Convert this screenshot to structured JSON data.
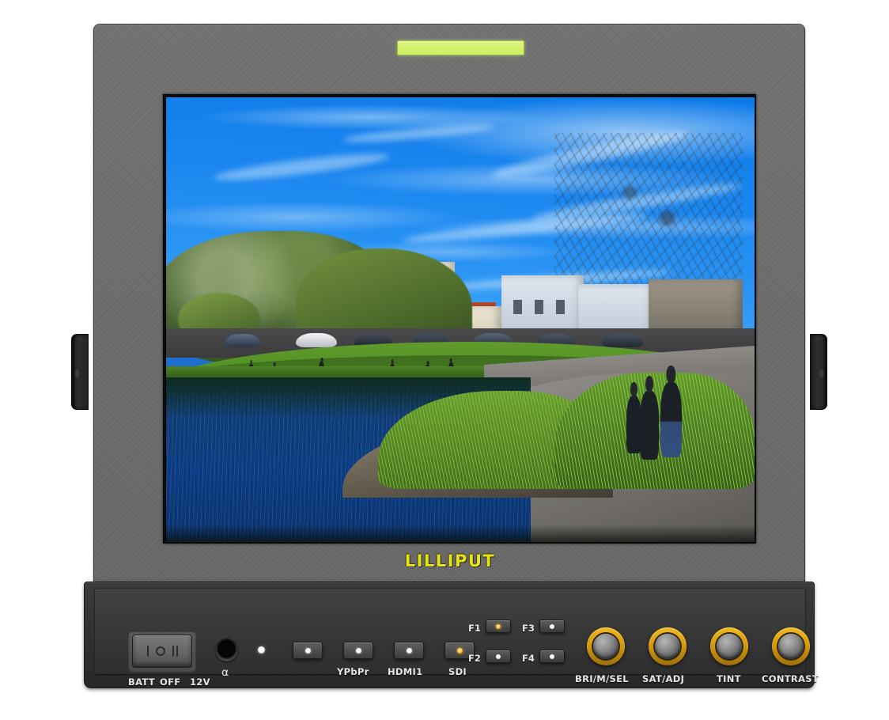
{
  "device": {
    "brand": "LILLIPUT",
    "tally_color": "#d4f26a",
    "bezel_color": "#6d6d6d",
    "panel_color": "#373737",
    "knob_ring_color": "#d79b10",
    "led_amber_color": "#f4b015",
    "brand_color": "#e8e60d"
  },
  "screen": {
    "content_description": "Park scene: blue sky with wispy cirrus clouds, trees, row of houses on a hill, green lawn, parked cars, pond with rippled blue water, curved walking path with people"
  },
  "controls": {
    "power_switch": {
      "name": "power-rocker-switch",
      "labels": [
        "BATT",
        "OFF",
        "12V"
      ],
      "position": "OFF"
    },
    "headphone_jack": {
      "label": "headphone"
    },
    "status_led": {
      "label": "power-led",
      "state": "on",
      "color": "#ffffff"
    },
    "source_buttons": [
      {
        "label": "",
        "led": "white"
      },
      {
        "label": "YPbPr",
        "led": "white"
      },
      {
        "label": "HDMI1",
        "led": "white"
      },
      {
        "label": "SDI",
        "led": "amber"
      }
    ],
    "function_buttons": [
      {
        "label": "F1",
        "led": "amber"
      },
      {
        "label": "F2",
        "led": "white"
      },
      {
        "label": "F3",
        "led": "white"
      },
      {
        "label": "F4",
        "led": "white"
      }
    ],
    "knobs": [
      {
        "label": "BRI/M/SEL"
      },
      {
        "label": "SAT/ADJ"
      },
      {
        "label": "TINT"
      },
      {
        "label": "CONTRAST"
      }
    ]
  }
}
